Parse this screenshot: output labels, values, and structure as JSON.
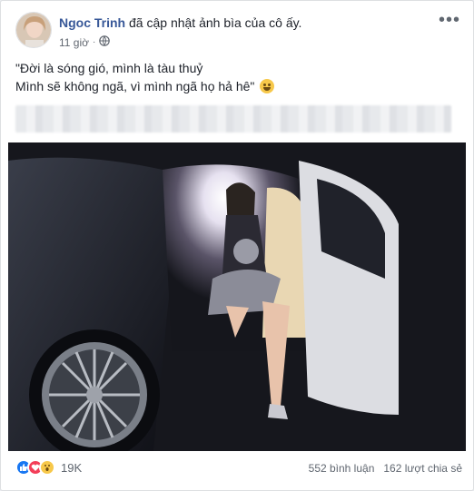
{
  "post": {
    "author": "Ngoc Trinh",
    "action": " đã cập nhật ảnh bìa của cô ấy.",
    "time": "11 giờ",
    "dot": "·",
    "privacy_icon": "globe-icon",
    "more_icon": "more-options-icon",
    "text_line1": "\"Đời là sóng gió, mình là tàu thuỷ",
    "text_line2": "Mình sẽ không ngã, vì mình ngã họ hả hê\"",
    "emoji": "grinning-face-emoji"
  },
  "footer": {
    "reaction_count": "19K",
    "comments": "552 bình luận",
    "shares": "162 lượt chia sẻ",
    "reactions": [
      "like-icon",
      "love-icon",
      "wow-icon"
    ]
  },
  "colors": {
    "author": "#385898",
    "like": "#1877f2",
    "love": "#f33e58",
    "wow": "#f7c84a"
  }
}
